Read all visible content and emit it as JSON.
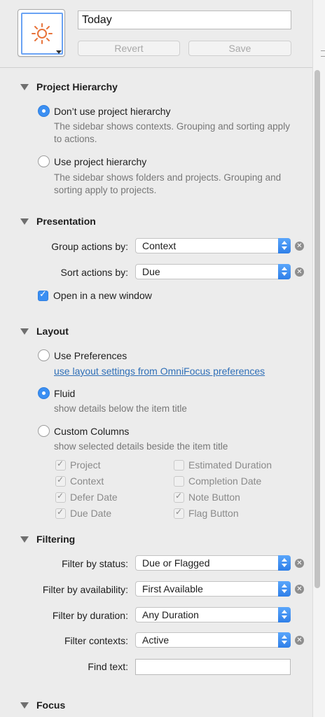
{
  "header": {
    "title_value": "Today",
    "icon": "sun-icon",
    "revert_label": "Revert",
    "save_label": "Save"
  },
  "project_hierarchy": {
    "title": "Project Hierarchy",
    "options": [
      {
        "label": "Don’t use project hierarchy",
        "description": "The sidebar shows contexts. Grouping and sorting apply to actions.",
        "selected": true
      },
      {
        "label": "Use project hierarchy",
        "description": "The sidebar shows folders and projects. Grouping and sorting apply to projects.",
        "selected": false
      }
    ]
  },
  "presentation": {
    "title": "Presentation",
    "group_label": "Group actions by:",
    "group_value": "Context",
    "sort_label": "Sort actions by:",
    "sort_value": "Due",
    "open_new_window_label": "Open in a new window",
    "open_new_window_checked": true
  },
  "layout": {
    "title": "Layout",
    "use_prefs_label": "Use Preferences",
    "use_prefs_link": "use layout settings from OmniFocus preferences",
    "fluid_label": "Fluid",
    "fluid_desc": "show details below the item title",
    "custom_label": "Custom Columns",
    "custom_desc": "show selected details beside the item title",
    "selected": "Fluid",
    "columns_left": [
      {
        "label": "Project",
        "checked": true
      },
      {
        "label": "Context",
        "checked": true
      },
      {
        "label": "Defer Date",
        "checked": true
      },
      {
        "label": "Due Date",
        "checked": true
      }
    ],
    "columns_right": [
      {
        "label": "Estimated Duration",
        "checked": false
      },
      {
        "label": "Completion Date",
        "checked": false
      },
      {
        "label": "Note Button",
        "checked": true
      },
      {
        "label": "Flag Button",
        "checked": true
      }
    ]
  },
  "filtering": {
    "title": "Filtering",
    "status_label": "Filter by status:",
    "status_value": "Due or Flagged",
    "availability_label": "Filter by availability:",
    "availability_value": "First Available",
    "duration_label": "Filter by duration:",
    "duration_value": "Any Duration",
    "contexts_label": "Filter contexts:",
    "contexts_value": "Active",
    "find_label": "Find text:",
    "find_value": ""
  },
  "focus": {
    "title": "Focus"
  },
  "colors": {
    "accent": "#3b8ff2",
    "sun_icon": "#e8733a",
    "link": "#2f6fb7"
  }
}
